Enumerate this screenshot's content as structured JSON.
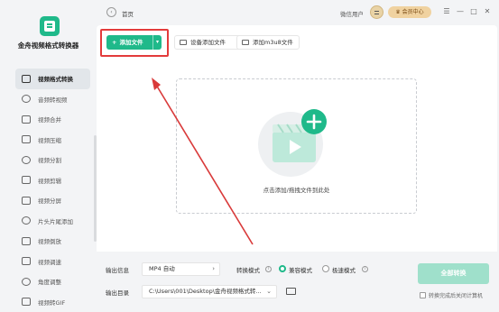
{
  "app": {
    "name": "金舟视频格式转换器",
    "accent": "#1fb98a"
  },
  "sidebar": {
    "items": [
      {
        "label": "视频格式转换",
        "icon": "video-convert-icon",
        "active": true
      },
      {
        "label": "音频转视频",
        "icon": "audio-to-video-icon"
      },
      {
        "label": "视频合并",
        "icon": "video-merge-icon"
      },
      {
        "label": "视频压缩",
        "icon": "video-compress-icon"
      },
      {
        "label": "视频分割",
        "icon": "video-split-icon"
      },
      {
        "label": "视频剪辑",
        "icon": "video-edit-icon"
      },
      {
        "label": "视频分屏",
        "icon": "video-splitscreen-icon"
      },
      {
        "label": "片头片尾添加",
        "icon": "intro-outro-icon"
      },
      {
        "label": "视频倒放",
        "icon": "video-reverse-icon"
      },
      {
        "label": "视频调速",
        "icon": "video-speed-icon"
      },
      {
        "label": "角度调整",
        "icon": "rotate-icon"
      },
      {
        "label": "视频转GIF",
        "icon": "video-gif-icon"
      }
    ]
  },
  "header": {
    "breadcrumb": "首页",
    "user_name": "微信用户",
    "vip_label": "会员中心",
    "window_controls": [
      "☰",
      "—",
      "□",
      "✕"
    ]
  },
  "toolbar": {
    "add_file_label": "添加文件",
    "add_device_label": "设备添加文件",
    "add_m3u8_label": "添加m3u8文件"
  },
  "dropzone": {
    "hint": "点击添加/拖拽文件到此处"
  },
  "settings": {
    "output_info_label": "输出信息",
    "output_format": "MP4 自动",
    "convert_mode_label": "转换模式",
    "mode_compatible": "兼容模式",
    "mode_fast": "极速模式",
    "output_dir_label": "输出目录",
    "output_path": "C:\\Users\\001\\Desktop\\金舟视频格式转...",
    "convert_all_label": "全部转换",
    "shutdown_label": "转换完成后关闭计算机"
  }
}
